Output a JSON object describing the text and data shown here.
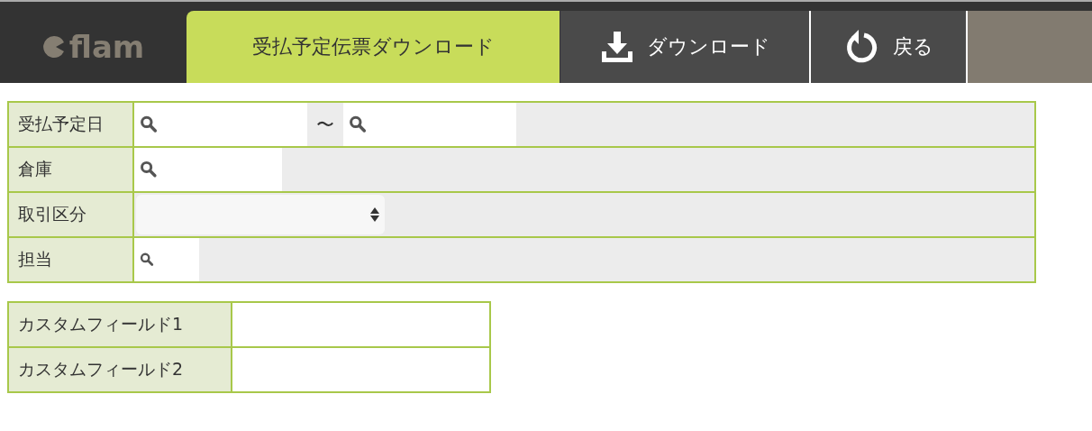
{
  "header": {
    "logo": "flam",
    "tabs": [
      {
        "label": "受払予定伝票ダウンロード",
        "selected": true
      }
    ],
    "buttons": [
      {
        "kind": "download",
        "label": "ダウンロード"
      },
      {
        "kind": "back",
        "label": "戻る"
      }
    ]
  },
  "filters": [
    {
      "label": "受払予定日",
      "kind": "range",
      "separator": "〜"
    },
    {
      "label": "倉庫",
      "kind": "search"
    },
    {
      "label": "取引区分",
      "kind": "select"
    },
    {
      "label": "担当",
      "kind": "search"
    }
  ],
  "custom_fields": [
    {
      "label": "カスタムフィールド1"
    },
    {
      "label": "カスタムフィールド2"
    }
  ]
}
